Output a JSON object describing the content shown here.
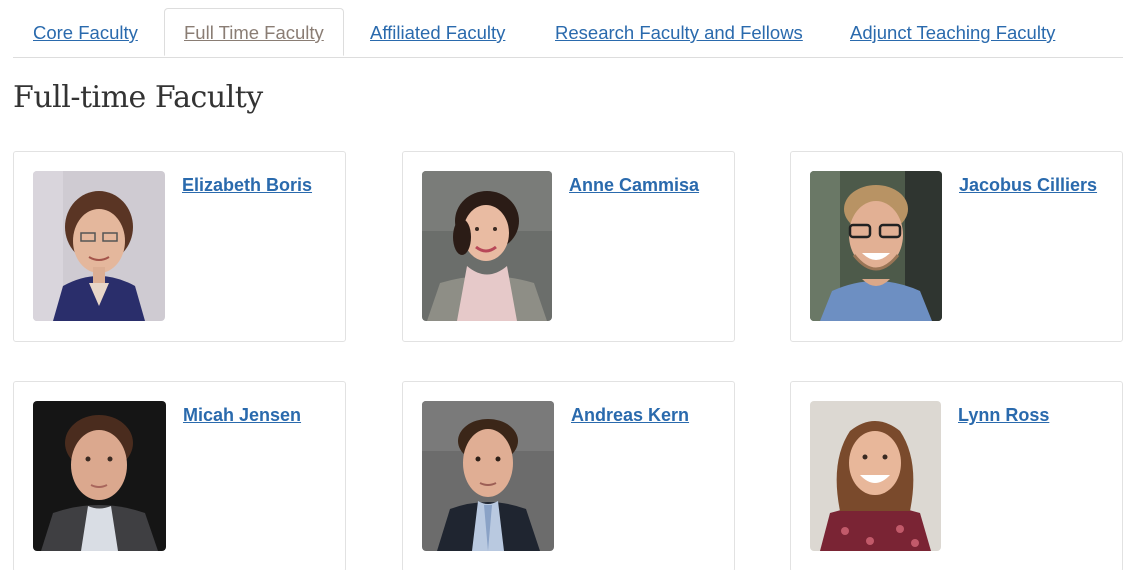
{
  "tabs": [
    {
      "label": "Core Faculty",
      "active": false
    },
    {
      "label": "Full Time Faculty",
      "active": true
    },
    {
      "label": "Affiliated Faculty",
      "active": false
    },
    {
      "label": "Research Faculty and Fellows",
      "active": false
    },
    {
      "label": "Adjunct Teaching Faculty",
      "active": false
    }
  ],
  "heading": "Full-time Faculty",
  "colors": {
    "link": "#2a6aad",
    "active_tab": "#8a7d74",
    "heading": "#333333",
    "border": "#e2e2e2"
  },
  "faculty": [
    {
      "name": "Elizabeth Boris",
      "photo": "portrait-photo"
    },
    {
      "name": "Anne Cammisa",
      "photo": "portrait-photo"
    },
    {
      "name": "Jacobus Cilliers",
      "photo": "portrait-photo"
    },
    {
      "name": "Micah Jensen",
      "photo": "portrait-photo"
    },
    {
      "name": "Andreas Kern",
      "photo": "portrait-photo"
    },
    {
      "name": "Lynn Ross",
      "photo": "portrait-photo"
    }
  ]
}
